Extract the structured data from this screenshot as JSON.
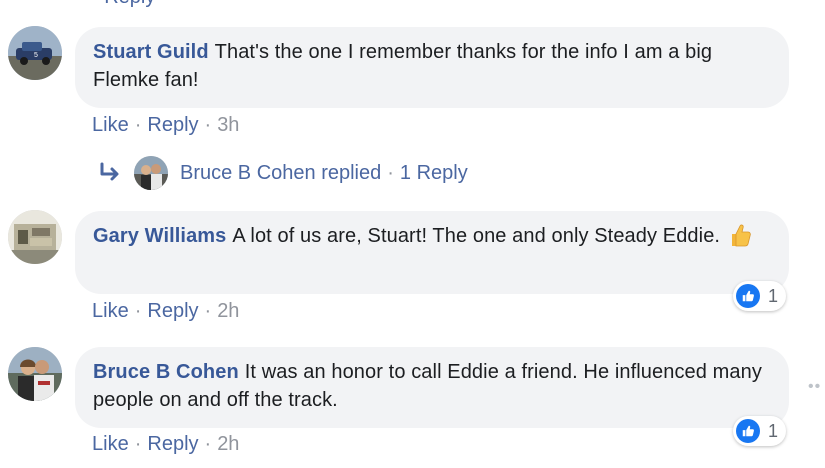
{
  "top_fragment": "· Reply ·",
  "comments": [
    {
      "author": "Stuart Guild",
      "text": "That's the one I remember thanks for the info I am a big Flemke fan!",
      "like_label": "Like",
      "reply_label": "Reply",
      "time": "3h"
    },
    {
      "author": "Gary Williams",
      "text": "A lot of us are, Stuart! The one and only Steady Eddie.",
      "emoji": "thumbs-up-emoji",
      "like_label": "Like",
      "reply_label": "Reply",
      "time": "2h",
      "reaction_count": "1"
    },
    {
      "author": "Bruce B Cohen",
      "text": "It was an honor to call Eddie a friend. He influenced many people on and off the track.",
      "like_label": "Like",
      "reply_label": "Reply",
      "time": "2h",
      "reaction_count": "1"
    }
  ],
  "reply_thread": {
    "label": "Bruce B Cohen replied",
    "count_label": "1 Reply"
  },
  "more_options": "••",
  "colors": {
    "link": "#385898",
    "action_link": "#4b67a1",
    "muted": "#90949c",
    "bubble": "#f2f3f5",
    "like_blue": "#1877f2"
  },
  "icons": [
    "reply-arrow-icon",
    "like-thumb-icon",
    "more-options-icon"
  ]
}
